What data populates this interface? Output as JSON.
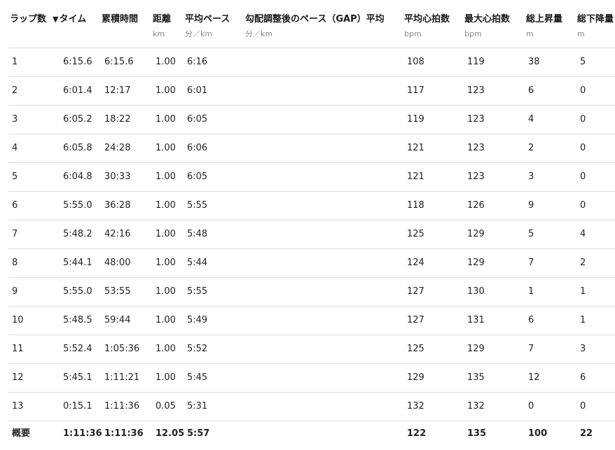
{
  "columns": [
    {
      "key": "lap",
      "label": "ラップ数",
      "unit": ""
    },
    {
      "key": "time",
      "label": "タイム",
      "unit": "",
      "sort_indicator": "▼"
    },
    {
      "key": "cumulative",
      "label": "累積時間",
      "unit": ""
    },
    {
      "key": "distance",
      "label": "距離",
      "unit": "km"
    },
    {
      "key": "avg_pace",
      "label": "平均ペース",
      "unit": "分／km"
    },
    {
      "key": "gap",
      "label": "勾配調整後のペース（GAP）平均",
      "unit": "分／km"
    },
    {
      "key": "avg_hr",
      "label": "平均心拍数",
      "unit": "bpm"
    },
    {
      "key": "max_hr",
      "label": "最大心拍数",
      "unit": "bpm"
    },
    {
      "key": "ascent",
      "label": "総上昇量",
      "unit": "m"
    },
    {
      "key": "descent",
      "label": "総下降量",
      "unit": "m"
    }
  ],
  "rows": [
    [
      "1",
      "6:15.6",
      "6:15.6",
      "1.00",
      "6:16",
      "",
      "108",
      "119",
      "38",
      "5"
    ],
    [
      "2",
      "6:01.4",
      "12:17",
      "1.00",
      "6:01",
      "",
      "117",
      "123",
      "6",
      "0"
    ],
    [
      "3",
      "6:05.2",
      "18:22",
      "1.00",
      "6:05",
      "",
      "119",
      "123",
      "4",
      "0"
    ],
    [
      "4",
      "6:05.8",
      "24:28",
      "1.00",
      "6:06",
      "",
      "121",
      "123",
      "2",
      "0"
    ],
    [
      "5",
      "6:04.8",
      "30:33",
      "1.00",
      "6:05",
      "",
      "121",
      "123",
      "3",
      "0"
    ],
    [
      "6",
      "5:55.0",
      "36:28",
      "1.00",
      "5:55",
      "",
      "118",
      "126",
      "9",
      "0"
    ],
    [
      "7",
      "5:48.2",
      "42:16",
      "1.00",
      "5:48",
      "",
      "125",
      "129",
      "5",
      "4"
    ],
    [
      "8",
      "5:44.1",
      "48:00",
      "1.00",
      "5:44",
      "",
      "124",
      "129",
      "7",
      "2"
    ],
    [
      "9",
      "5:55.0",
      "53:55",
      "1.00",
      "5:55",
      "",
      "127",
      "130",
      "1",
      "1"
    ],
    [
      "10",
      "5:48.5",
      "59:44",
      "1.00",
      "5:49",
      "",
      "127",
      "131",
      "6",
      "1"
    ],
    [
      "11",
      "5:52.4",
      "1:05:36",
      "1.00",
      "5:52",
      "",
      "125",
      "129",
      "7",
      "3"
    ],
    [
      "12",
      "5:45.1",
      "1:11:21",
      "1.00",
      "5:45",
      "",
      "129",
      "135",
      "12",
      "6"
    ],
    [
      "13",
      "0:15.1",
      "1:11:36",
      "0.05",
      "5:31",
      "",
      "132",
      "132",
      "0",
      "0"
    ]
  ],
  "summary": [
    "概要",
    "1:11:36",
    "1:11:36",
    "12.05",
    "5:57",
    "",
    "122",
    "135",
    "100",
    "22"
  ]
}
